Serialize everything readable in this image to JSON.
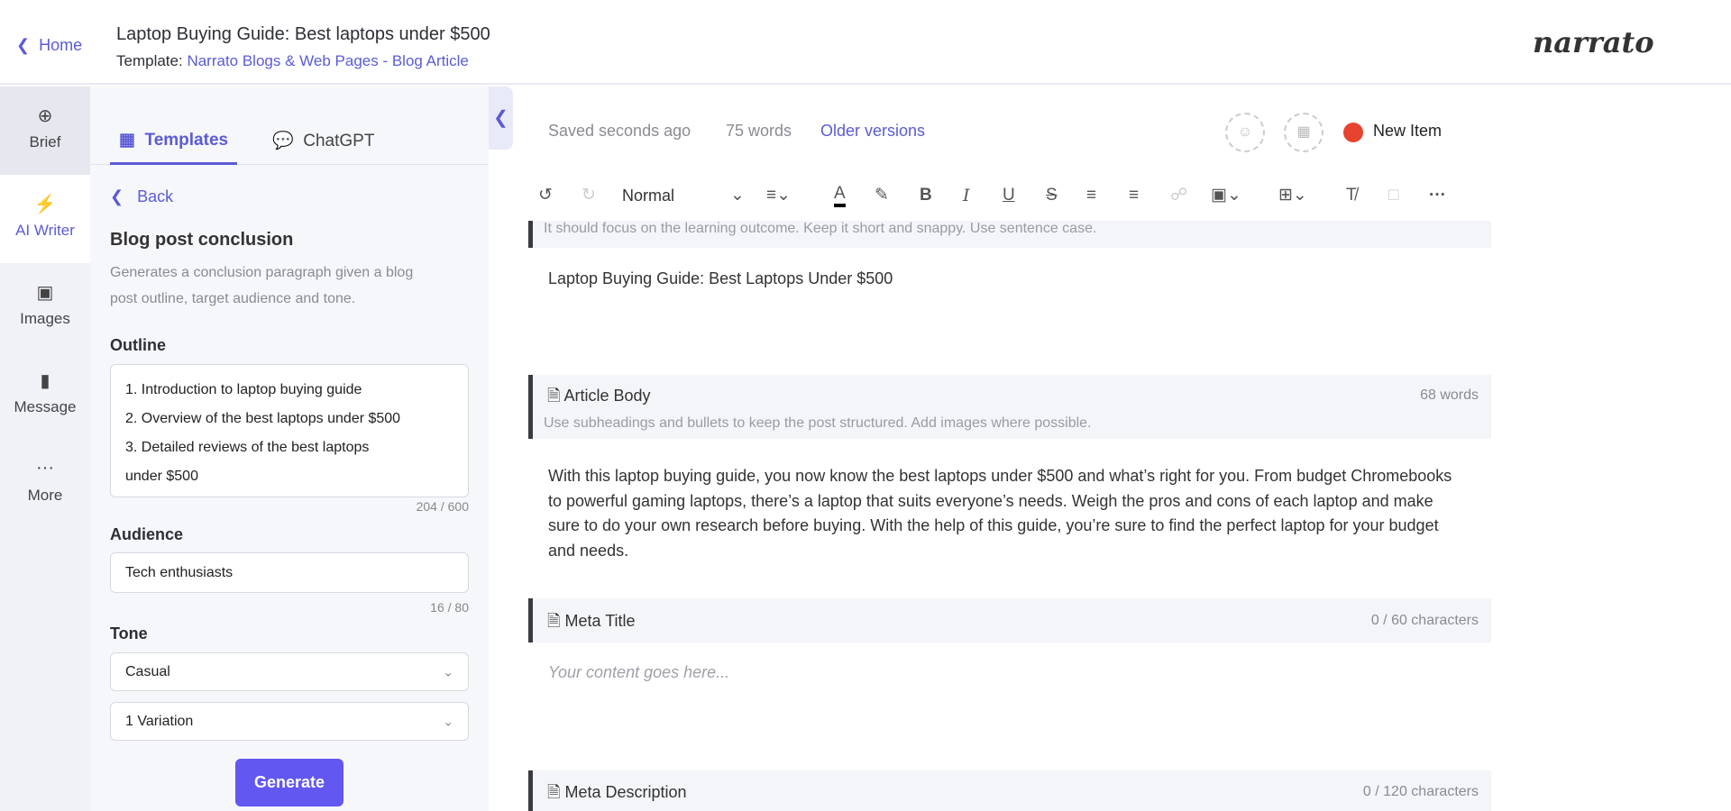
{
  "header": {
    "home_label": "Home",
    "title": "Laptop Buying Guide: Best laptops under $500",
    "template_prefix": "Template:",
    "template_name": "Narrato Blogs & Web Pages - Blog Article",
    "logo": "narrato"
  },
  "rail": {
    "items": [
      {
        "label": "Brief",
        "icon": "crosshair-icon"
      },
      {
        "label": "AI Writer",
        "icon": "lightning-icon"
      },
      {
        "label": "Images",
        "icon": "image-icon"
      },
      {
        "label": "Message",
        "icon": "chat-icon"
      },
      {
        "label": "More",
        "icon": "ellipsis-icon"
      }
    ]
  },
  "panel": {
    "tabs": [
      {
        "label": "Templates",
        "active": true
      },
      {
        "label": "ChatGPT",
        "active": false
      }
    ],
    "back_label": "Back",
    "tool_title": "Blog post conclusion",
    "tool_desc_1": "Generates a conclusion paragraph given a blog",
    "tool_desc_2": "post outline, target audience and tone.",
    "outline_label": "Outline",
    "outline_lines": [
      "1. Introduction to laptop buying guide",
      "2. Overview of the best laptops under $500",
      "3. Detailed reviews of the best laptops",
      "under $500"
    ],
    "outline_counter": "204 / 600",
    "audience_label": "Audience",
    "audience_value": "Tech enthusiasts",
    "audience_counter": "16 / 80",
    "tone_label": "Tone",
    "tone_value": "Casual",
    "variations_value": "1 Variation",
    "generate_label": "Generate"
  },
  "editor": {
    "saved": "Saved seconds ago",
    "words": "75 words",
    "older_versions": "Older versions",
    "status": "New Item",
    "status_color": "#e8432f",
    "toolbar": {
      "style": "Normal"
    },
    "title_hint": "It should focus on the learning outcome. Keep it short and snappy. Use sentence case.",
    "title_value": "Laptop Buying Guide: Best Laptops Under $500",
    "sections": [
      {
        "name": "Article Body",
        "count": "68 words",
        "hint": "Use subheadings and bullets to keep the post structured. Add images where possible.",
        "content": "With this laptop buying guide, you now know the best laptops under $500 and what’s right for you. From budget Chromebooks to powerful gaming laptops, there’s a laptop that suits everyone’s needs. Weigh the pros and cons of each laptop and make sure to do your own research before buying. With the help of this guide, you’re sure to find the perfect laptop for your budget and needs."
      },
      {
        "name": "Meta Title",
        "count": "0 / 60 characters",
        "placeholder": "Your content goes here..."
      },
      {
        "name": "Meta Description",
        "count": "0 / 120 characters"
      }
    ]
  }
}
